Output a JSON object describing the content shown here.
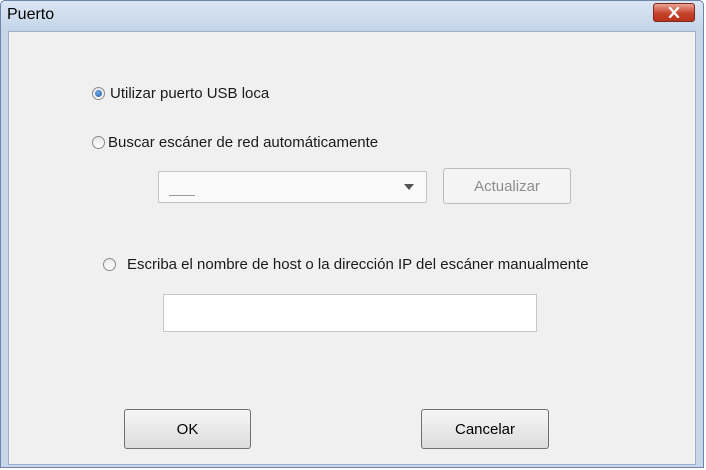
{
  "window": {
    "title": "Puerto"
  },
  "options": {
    "usb_label": "Utilizar puerto USB loca",
    "auto_label": "Buscar escáner de red automáticamente",
    "manual_label": "Escriba el nombre de host o la dirección IP del escáner manualmente",
    "selected": "usb"
  },
  "scanner_select": {
    "value": ""
  },
  "host_input": {
    "value": ""
  },
  "buttons": {
    "refresh_label": "Actualizar",
    "ok_label": "OK",
    "cancel_label": "Cancelar"
  },
  "icons": {
    "close": "close-icon",
    "dropdown": "chevron-down-icon"
  },
  "colors": {
    "title_bar": "#c4d4e8",
    "close_button": "#c7432a",
    "radio_selected": "#1c5fab",
    "dialog_background": "#f0f0f0"
  }
}
